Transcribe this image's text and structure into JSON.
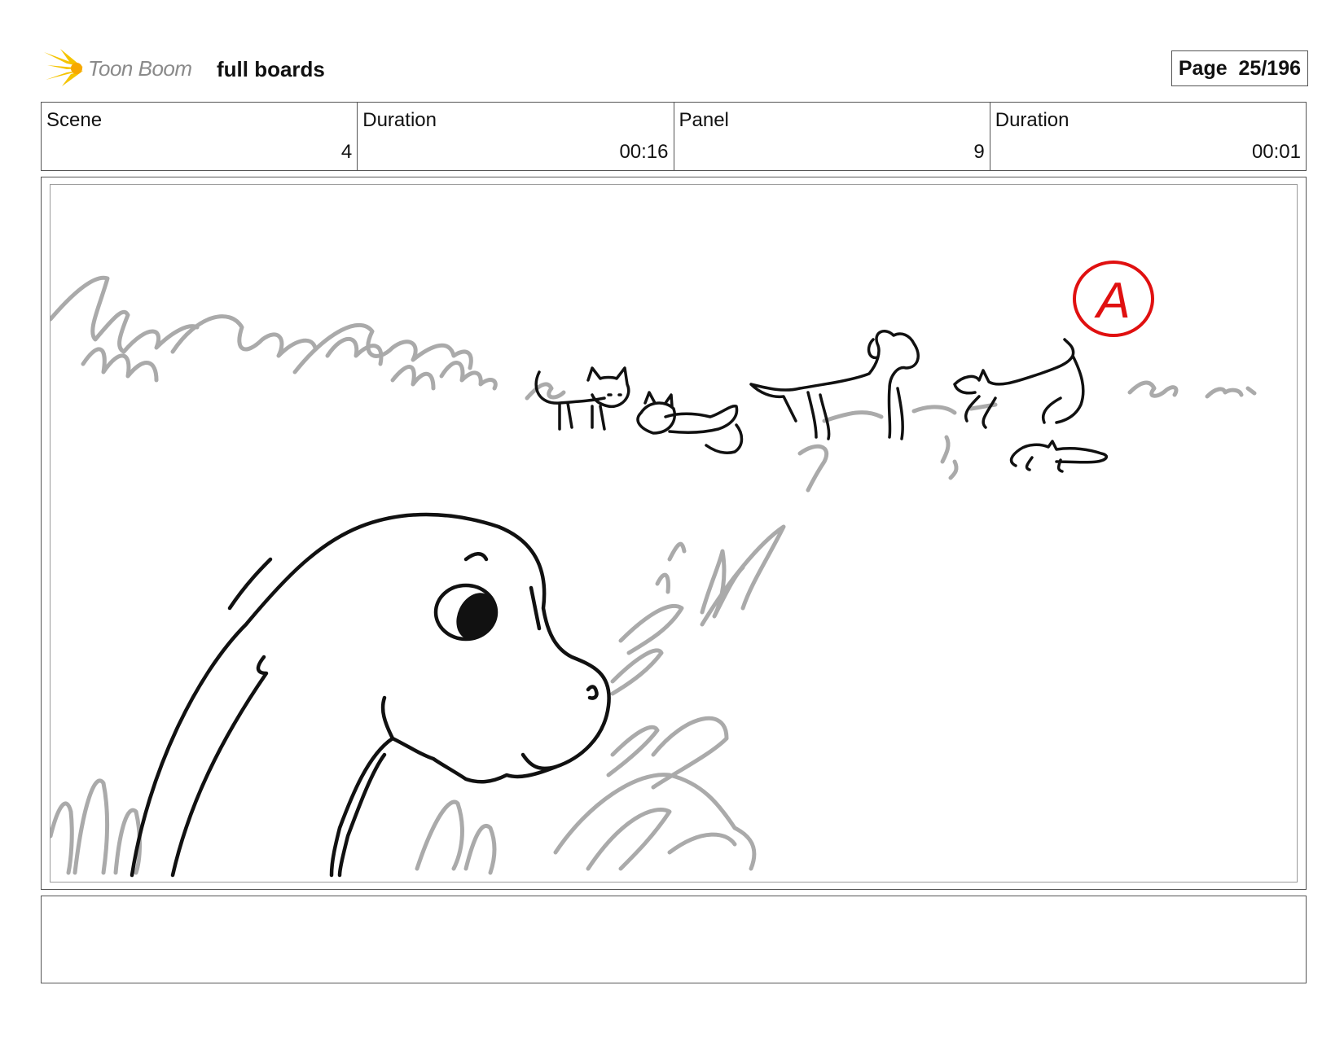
{
  "header": {
    "logo_text": "Toon Boom",
    "doc_title": "full boards",
    "page_label": "Page",
    "page_value": "25/196"
  },
  "info": [
    {
      "label": "Scene",
      "value": "4"
    },
    {
      "label": "Duration",
      "value": "00:16"
    },
    {
      "label": "Panel",
      "value": "9"
    },
    {
      "label": "Duration",
      "value": "00:01"
    }
  ],
  "panel": {
    "annotation": "A",
    "annotation_color": "#e01010",
    "line_color": "#111111",
    "grass_color": "#aaaaaa"
  },
  "notes": ""
}
